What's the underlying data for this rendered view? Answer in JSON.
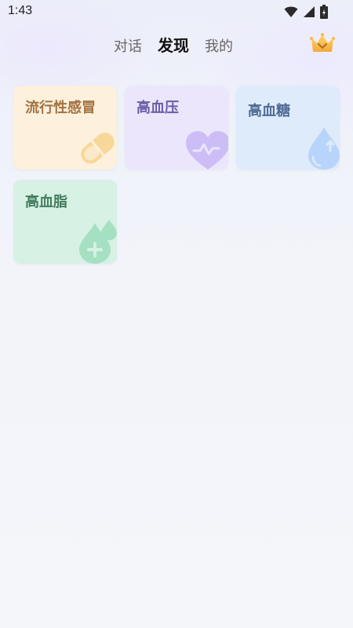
{
  "status_bar": {
    "time": "1:43",
    "icons": [
      "wifi-icon",
      "cell-signal-icon",
      "battery-icon"
    ]
  },
  "nav": {
    "tabs": [
      {
        "label": "对话",
        "active": false
      },
      {
        "label": "发现",
        "active": true
      },
      {
        "label": "我的",
        "active": false
      }
    ],
    "vip_icon": "crown-icon"
  },
  "cards": [
    {
      "label": "流行性感冒",
      "icon": "pill-icon",
      "bg": "#fdf1dd",
      "text_color": "#a27240"
    },
    {
      "label": "高血压",
      "icon": "heart-pulse-icon",
      "bg": "#ebe6fb",
      "text_color": "#6c5ca9"
    },
    {
      "label": "高血糖",
      "icon": "drop-arrow-up-icon",
      "bg": "#deebfb",
      "text_color": "#4e6a96"
    },
    {
      "label": "高血脂",
      "icon": "drop-plus-icon",
      "bg": "#d7f1e4",
      "text_color": "#437c5e"
    }
  ]
}
